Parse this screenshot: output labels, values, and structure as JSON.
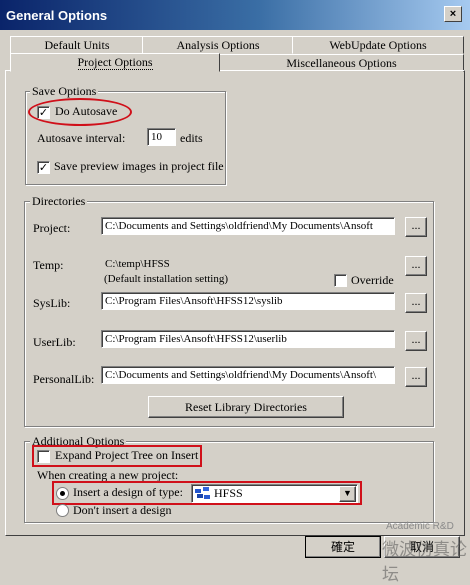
{
  "window": {
    "title": "General Options",
    "close_glyph": "×"
  },
  "tabs_row1": [
    "Default Units",
    "Analysis Options",
    "WebUpdate Options"
  ],
  "tabs_row2": [
    "Project Options",
    "Miscellaneous Options"
  ],
  "save_options": {
    "title": "Save Options",
    "do_autosave": "Do Autosave",
    "do_autosave_checked": true,
    "autosave_interval_label": "Autosave interval:",
    "autosave_interval_value": "10",
    "autosave_unit": "edits",
    "save_preview": "Save preview images in project file",
    "save_preview_checked": true
  },
  "directories": {
    "title": "Directories",
    "browse_label": "...",
    "project_label": "Project:",
    "project_value": "C:\\Documents and Settings\\oldfriend\\My Documents\\Ansoft",
    "temp_label": "Temp:",
    "temp_value": "C:\\temp\\HFSS",
    "temp_note": "(Default installation setting)",
    "override_label": "Override",
    "syslib_label": "SysLib:",
    "syslib_value": "C:\\Program Files\\Ansoft\\HFSS12\\syslib",
    "userlib_label": "UserLib:",
    "userlib_value": "C:\\Program Files\\Ansoft\\HFSS12\\userlib",
    "personallib_label": "PersonalLib:",
    "personallib_value": "C:\\Documents and Settings\\oldfriend\\My Documents\\Ansoft\\",
    "reset_button": "Reset Library Directories"
  },
  "additional_options": {
    "title": "Additional Options",
    "expand_tree": "Expand Project Tree on Insert",
    "expand_tree_checked": false,
    "creating_label": "When creating a new project:",
    "insert_design": "Insert a design of type:",
    "design_type": "HFSS",
    "dont_insert": "Don't insert a design"
  },
  "footer": {
    "ok_button": "確定",
    "cancel_button": "取消"
  },
  "watermark": {
    "line1": "Academic R&D",
    "line2": "微波仿真论坛"
  },
  "colors": {
    "highlight": "#d0101a",
    "titlebar": "#0a246a"
  }
}
